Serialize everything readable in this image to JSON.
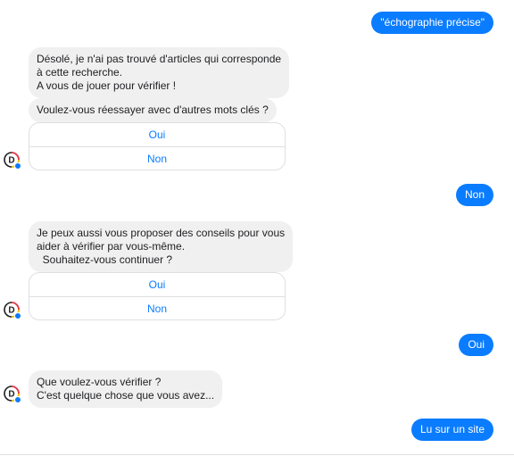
{
  "colors": {
    "user_bubble": "#0a7cff",
    "bot_bubble": "#f1f0f0",
    "quick_reply_text": "#0a7cff"
  },
  "avatar": {
    "letter": "D",
    "icon": "d-logo-icon"
  },
  "messages": {
    "user_1": "\"échographie précise\"",
    "bot_1": "Désolé, je n'ai pas trouvé d'articles qui corresponde\nà cette recherche.\nA vous de jouer pour vérifier !",
    "bot_2": "Voulez-vous réessayer avec d'autres mots clés ?",
    "qr_1_yes": "Oui",
    "qr_1_no": "Non",
    "user_2": "Non",
    "bot_3": "Je peux aussi vous proposer des conseils pour vous\naider à vérifier par vous-même.\n  Souhaitez-vous continuer ?",
    "qr_2_yes": "Oui",
    "qr_2_no": "Non",
    "user_3": "Oui",
    "bot_4": "Que voulez-vous vérifier ?\nC'est quelque chose que vous avez...",
    "user_4": "Lu sur un site"
  }
}
